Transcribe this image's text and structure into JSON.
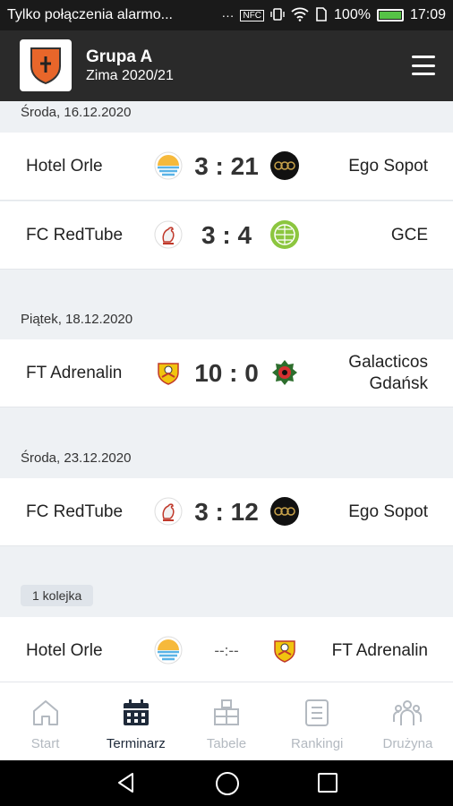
{
  "status_bar": {
    "notification": "Tylko połączenia alarmo...",
    "more": "···",
    "nfc": "NFC",
    "battery_percent": "100%",
    "time": "17:09"
  },
  "header": {
    "title": "Grupa A",
    "subtitle": "Zima 2020/21"
  },
  "sections": [
    {
      "date": "Środa, 16.12.2020",
      "matches": [
        {
          "home": "Hotel Orle",
          "score": "3 : 21",
          "away": "Ego Sopot"
        },
        {
          "home": "FC RedTube",
          "score": "3 : 4",
          "away": "GCE"
        }
      ]
    },
    {
      "date": "Piątek, 18.12.2020",
      "matches": [
        {
          "home": "FT Adrenalin",
          "score": "10 : 0",
          "away": "Galacticos Gdańsk"
        }
      ]
    },
    {
      "date": "Środa, 23.12.2020",
      "matches": [
        {
          "home": "FC RedTube",
          "score": "3 : 12",
          "away": "Ego Sopot"
        }
      ]
    },
    {
      "round": "1 kolejka",
      "matches": [
        {
          "home": "Hotel Orle",
          "score": "--:--",
          "away": "FT Adrenalin"
        }
      ]
    }
  ],
  "bottom_nav": [
    {
      "label": "Start",
      "icon": "home-icon",
      "active": false
    },
    {
      "label": "Terminarz",
      "icon": "calendar-icon",
      "active": true
    },
    {
      "label": "Tabele",
      "icon": "table-icon",
      "active": false
    },
    {
      "label": "Rankingi",
      "icon": "ranking-icon",
      "active": false
    },
    {
      "label": "Drużyna",
      "icon": "team-icon",
      "active": false
    }
  ],
  "colors": {
    "header_bg": "#2a2a2a",
    "active_nav": "#1f2a3a",
    "inactive_nav": "#b3b9c0",
    "page_bg": "#eef1f4"
  }
}
